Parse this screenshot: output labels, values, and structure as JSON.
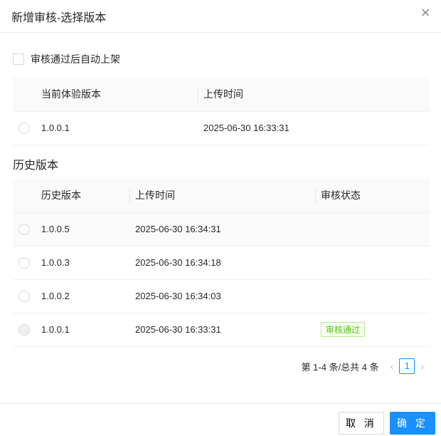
{
  "dialog": {
    "title": "新增审核-选择版本"
  },
  "auto_publish": {
    "label": "审核通过后自动上架",
    "checked": false
  },
  "current": {
    "headers": [
      "当前体验版本",
      "上传时间"
    ],
    "rows": [
      {
        "version": "1.0.0.1",
        "time": "2025-06-30 16:33:31"
      }
    ]
  },
  "history": {
    "title": "历史版本",
    "headers": [
      "历史版本",
      "上传时间",
      "审核状态"
    ],
    "rows": [
      {
        "version": "1.0.0.5",
        "time": "2025-06-30 16:34:31",
        "status": ""
      },
      {
        "version": "1.0.0.3",
        "time": "2025-06-30 16:34:18",
        "status": ""
      },
      {
        "version": "1.0.0.2",
        "time": "2025-06-30 16:34:03",
        "status": ""
      },
      {
        "version": "1.0.0.1",
        "time": "2025-06-30 16:33:31",
        "status": "审核通过"
      }
    ]
  },
  "pagination": {
    "summary": "第 1-4 条/总共 4 条",
    "current": "1"
  },
  "footer": {
    "cancel": "取 消",
    "ok": "确 定"
  }
}
